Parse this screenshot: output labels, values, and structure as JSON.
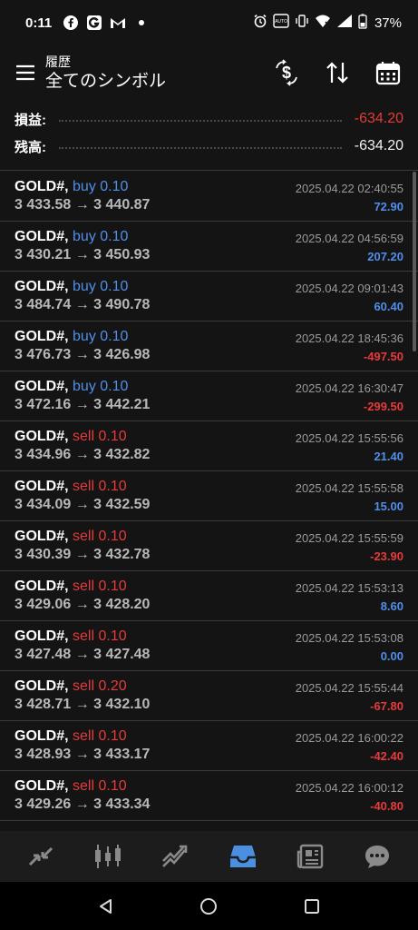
{
  "status": {
    "time": "0:11",
    "battery": "37%",
    "left_icons": [
      "facebook-icon",
      "g-app-icon",
      "gmail-icon",
      "dot-icon"
    ],
    "right_icons": [
      "alarm-icon",
      "nfc-icon",
      "vibrate-icon",
      "wifi-icon",
      "signal-icon",
      "battery-icon"
    ]
  },
  "header": {
    "subtitle": "履歴",
    "title": "全てのシンボル"
  },
  "summary": {
    "profit_label": "損益:",
    "profit_value": "-634.20",
    "balance_label": "残高:",
    "balance_value": "-634.20"
  },
  "colors": {
    "buy": "#4f8fea",
    "sell": "#e83a3a",
    "positive": "#4f8fea",
    "negative": "#e83a3a"
  },
  "trades": [
    {
      "symbol": "GOLD#,",
      "side": "buy",
      "volume": "0.10",
      "prices": "3 433.58 → 3 440.87",
      "time": "2025.04.22 02:40:55",
      "profit": "72.90",
      "sign": "pos"
    },
    {
      "symbol": "GOLD#,",
      "side": "buy",
      "volume": "0.10",
      "prices": "3 430.21 → 3 450.93",
      "time": "2025.04.22 04:56:59",
      "profit": "207.20",
      "sign": "pos"
    },
    {
      "symbol": "GOLD#,",
      "side": "buy",
      "volume": "0.10",
      "prices": "3 484.74 → 3 490.78",
      "time": "2025.04.22 09:01:43",
      "profit": "60.40",
      "sign": "pos"
    },
    {
      "symbol": "GOLD#,",
      "side": "buy",
      "volume": "0.10",
      "prices": "3 476.73 → 3 426.98",
      "time": "2025.04.22 18:45:36",
      "profit": "-497.50",
      "sign": "neg"
    },
    {
      "symbol": "GOLD#,",
      "side": "buy",
      "volume": "0.10",
      "prices": "3 472.16 → 3 442.21",
      "time": "2025.04.22 16:30:47",
      "profit": "-299.50",
      "sign": "neg"
    },
    {
      "symbol": "GOLD#,",
      "side": "sell",
      "volume": "0.10",
      "prices": "3 434.96 → 3 432.82",
      "time": "2025.04.22 15:55:56",
      "profit": "21.40",
      "sign": "pos"
    },
    {
      "symbol": "GOLD#,",
      "side": "sell",
      "volume": "0.10",
      "prices": "3 434.09 → 3 432.59",
      "time": "2025.04.22 15:55:58",
      "profit": "15.00",
      "sign": "pos"
    },
    {
      "symbol": "GOLD#,",
      "side": "sell",
      "volume": "0.10",
      "prices": "3 430.39 → 3 432.78",
      "time": "2025.04.22 15:55:59",
      "profit": "-23.90",
      "sign": "neg"
    },
    {
      "symbol": "GOLD#,",
      "side": "sell",
      "volume": "0.10",
      "prices": "3 429.06 → 3 428.20",
      "time": "2025.04.22 15:53:13",
      "profit": "8.60",
      "sign": "pos"
    },
    {
      "symbol": "GOLD#,",
      "side": "sell",
      "volume": "0.10",
      "prices": "3 427.48 → 3 427.48",
      "time": "2025.04.22 15:53:08",
      "profit": "0.00",
      "sign": "pos"
    },
    {
      "symbol": "GOLD#,",
      "side": "sell",
      "volume": "0.20",
      "prices": "3 428.71 → 3 432.10",
      "time": "2025.04.22 15:55:44",
      "profit": "-67.80",
      "sign": "neg"
    },
    {
      "symbol": "GOLD#,",
      "side": "sell",
      "volume": "0.10",
      "prices": "3 428.93 → 3 433.17",
      "time": "2025.04.22 16:00:22",
      "profit": "-42.40",
      "sign": "neg"
    },
    {
      "symbol": "GOLD#,",
      "side": "sell",
      "volume": "0.10",
      "prices": "3 429.26 → 3 433.34",
      "time": "2025.04.22 16:00:12",
      "profit": "-40.80",
      "sign": "neg"
    }
  ],
  "bottom_nav": [
    {
      "name": "quotes-icon",
      "active": false
    },
    {
      "name": "chart-icon",
      "active": false
    },
    {
      "name": "trade-icon",
      "active": false
    },
    {
      "name": "history-icon",
      "active": true
    },
    {
      "name": "news-icon",
      "active": false
    },
    {
      "name": "messages-icon",
      "active": false
    }
  ],
  "active_color": "#4a8fe0"
}
